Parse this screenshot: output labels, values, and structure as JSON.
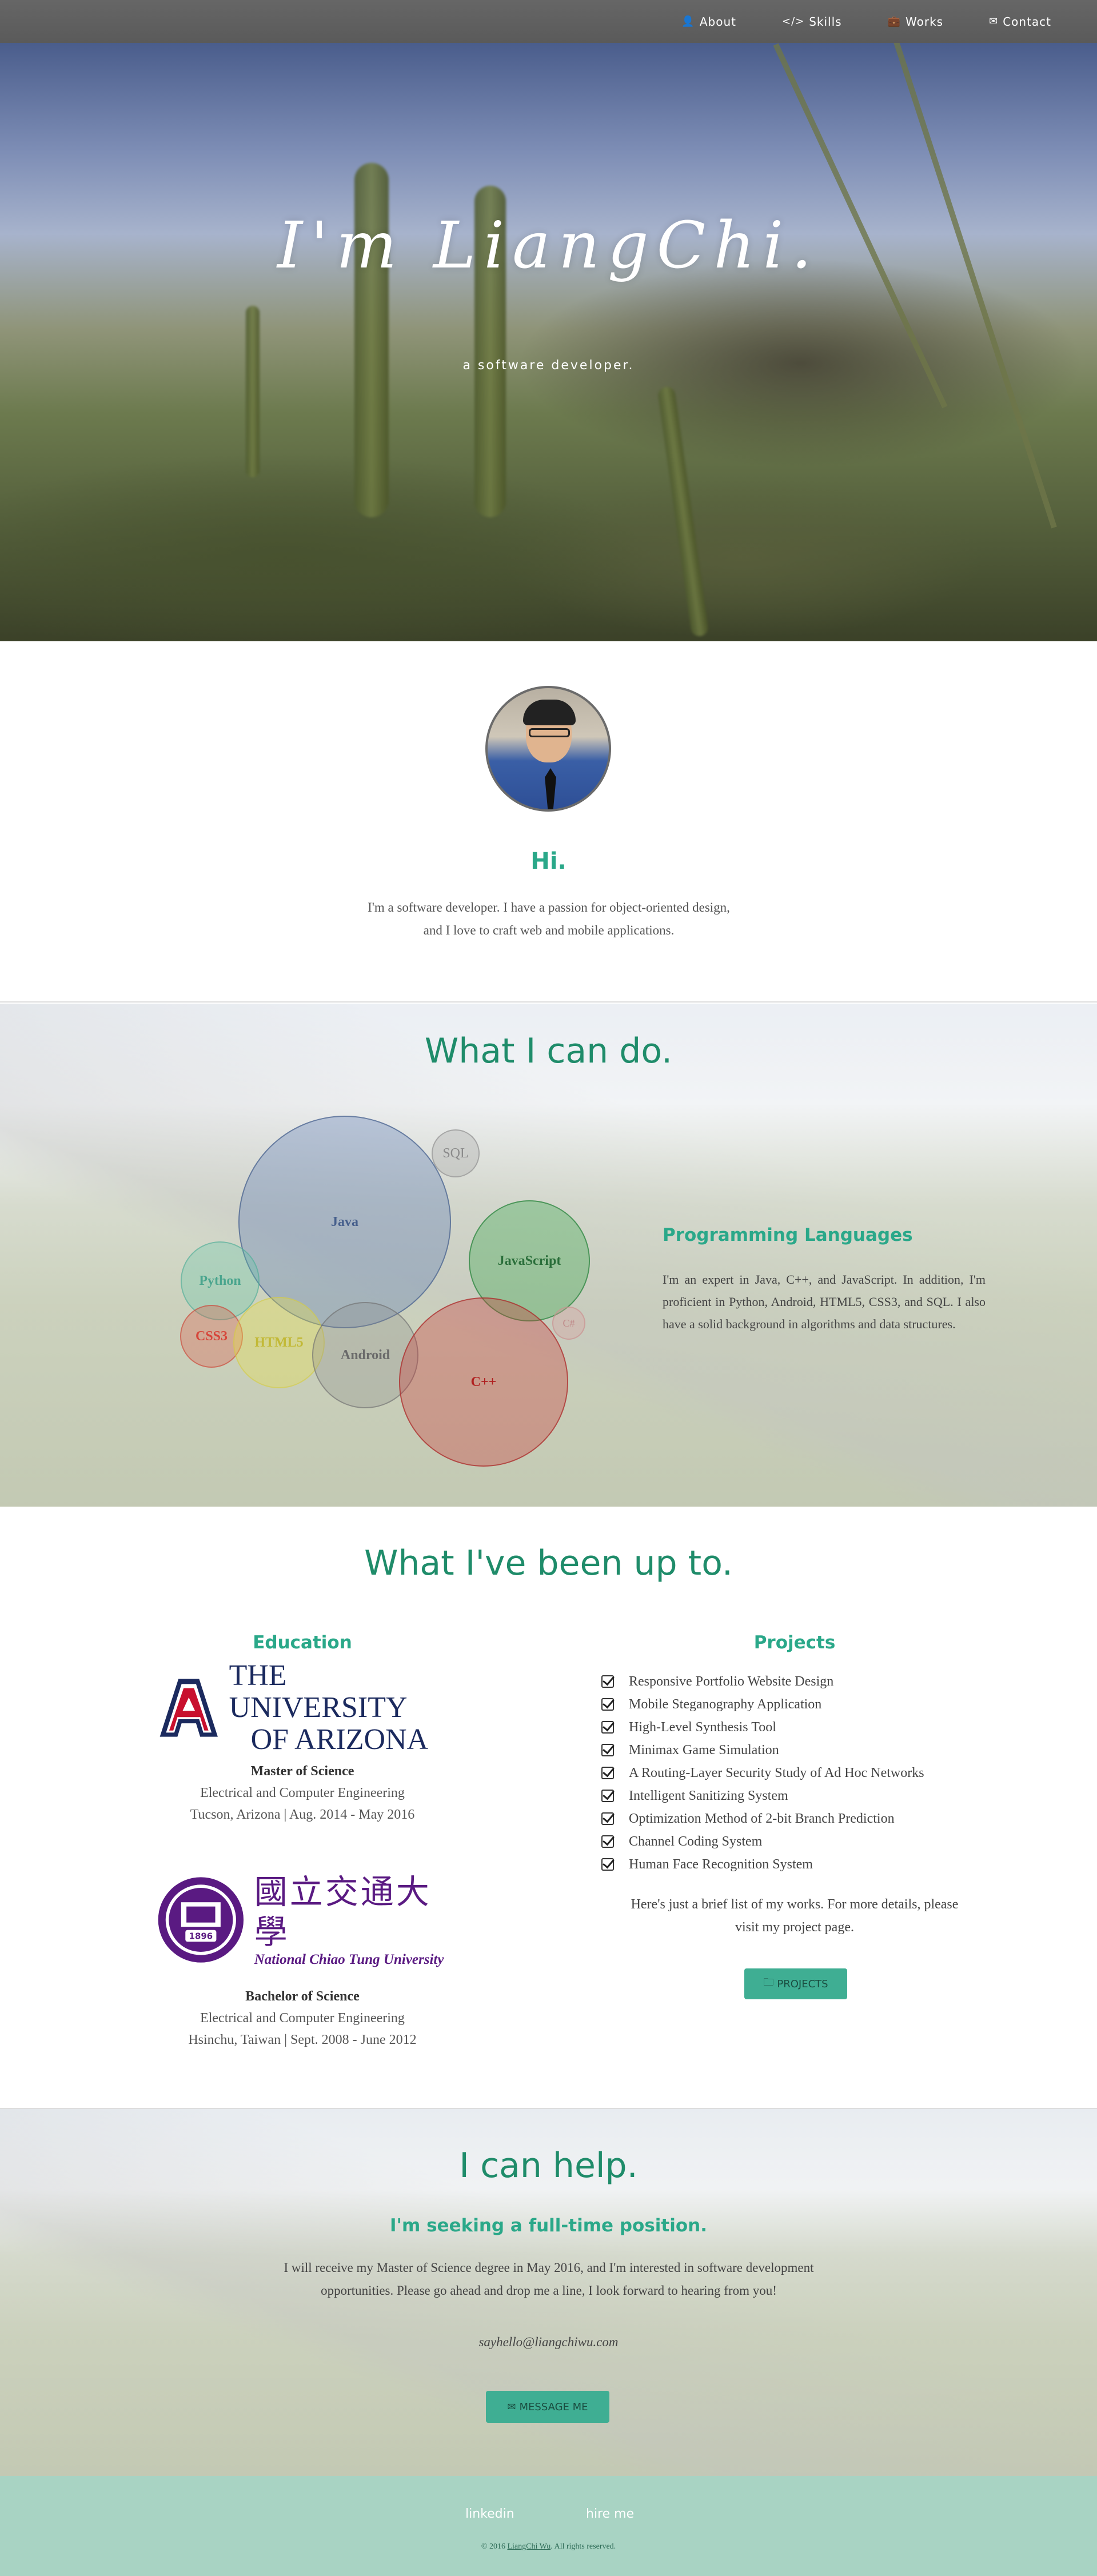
{
  "nav": {
    "items": [
      {
        "label": "About",
        "icon": "user-icon"
      },
      {
        "label": "Skills",
        "icon": "code-icon"
      },
      {
        "label": "Works",
        "icon": "briefcase-icon"
      },
      {
        "label": "Contact",
        "icon": "envelope-icon"
      }
    ]
  },
  "hero": {
    "title": "I'm LiangChi.",
    "subtitle": "a software developer."
  },
  "about": {
    "heading": "Hi.",
    "text": "I'm a software developer. I have a passion for object-oriented design, and I love to craft web and mobile applications."
  },
  "skills": {
    "title": "What I can do.",
    "bubbles": [
      {
        "label": "Java",
        "color": "#5b7cb5"
      },
      {
        "label": "SQL",
        "color": "#999999"
      },
      {
        "label": "JavaScript",
        "color": "#3aa84e"
      },
      {
        "label": "Python",
        "color": "#5cc6a8"
      },
      {
        "label": "CSS3",
        "color": "#e0503f"
      },
      {
        "label": "HTML5",
        "color": "#e8df4a"
      },
      {
        "label": "Android",
        "color": "#7a7a7a"
      },
      {
        "label": "C++",
        "color": "#cc2e2e"
      },
      {
        "label": "C#",
        "color": "#d9a0a0"
      }
    ],
    "heading": "Programming Languages",
    "text": "I'm an expert in Java, C++, and JavaScript. In addition, I'm proficient in Python, Android, HTML5, CSS3, and SQL. I also have a solid background in algorithms and data structures."
  },
  "experience": {
    "title": "What I've been up to.",
    "education": {
      "heading": "Education",
      "schools": [
        {
          "logo_text": [
            "THE UNIVERSITY",
            "OF ARIZONA"
          ],
          "degree": "Master of Science",
          "field": "Electrical and Computer Engineering",
          "detail": "Tucson, Arizona | Aug. 2014 - May 2016"
        },
        {
          "logo_text": [
            "國立交通大學",
            "National Chiao Tung University"
          ],
          "seal_year": "1896",
          "degree": "Bachelor of Science",
          "field": "Electrical and Computer Engineering",
          "detail": "Hsinchu, Taiwan | Sept. 2008 - June 2012"
        }
      ]
    },
    "projects": {
      "heading": "Projects",
      "items": [
        "Responsive Portfolio Website Design",
        "Mobile Steganography Application",
        "High-Level Synthesis Tool",
        "Minimax Game Simulation",
        "A Routing-Layer Security Study of Ad Hoc Networks",
        "Intelligent Sanitizing System",
        "Optimization Method of 2-bit Branch Prediction",
        "Channel Coding System",
        "Human Face Recognition System"
      ],
      "note": "Here's just a brief list of my works. For more details, please visit my project page.",
      "button": "PROJECTS"
    }
  },
  "contact": {
    "title": "I can help.",
    "subtitle": "I'm seeking a full-time position.",
    "text": "I will receive my Master of Science degree in May 2016, and I'm interested in software development opportunities. Please go ahead and drop me a line, I look forward to hearing from you!",
    "email": "sayhello@liangchiwu.com",
    "button": "MESSAGE ME"
  },
  "footer": {
    "links": [
      "linkedin",
      "hire me"
    ],
    "copy_prefix": "© 2016 ",
    "copy_link": "LiangChi Wu",
    "copy_suffix": ". All rights reserved."
  }
}
